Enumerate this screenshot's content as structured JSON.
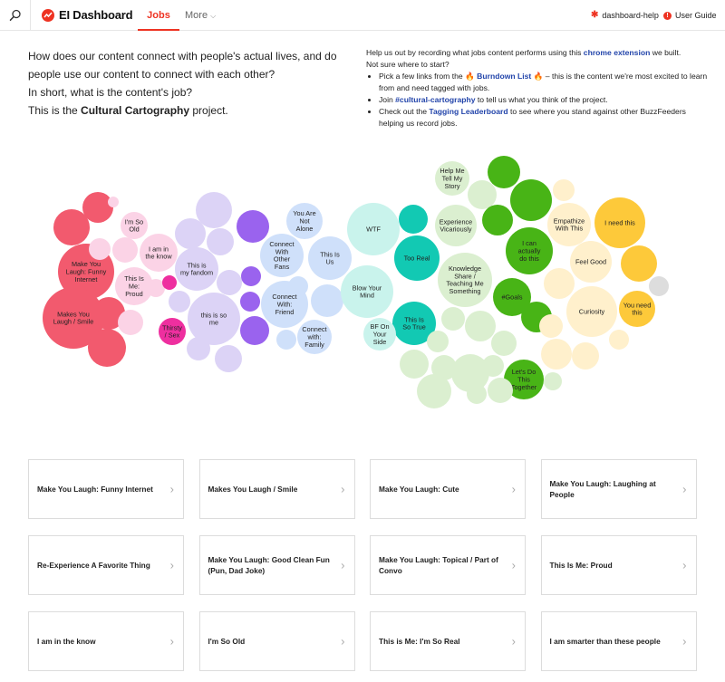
{
  "nav": {
    "brand": "EI Dashboard",
    "tabs": [
      {
        "label": "Jobs",
        "active": true
      },
      {
        "label": "More"
      }
    ],
    "help_link": "dashboard-help",
    "guide_link": "User Guide",
    "accent": "#ee3322"
  },
  "intro": {
    "line1": "How does our content connect with people's actual lives, and do people use our content to connect with each other?",
    "line2": "In short, what is the content's job?",
    "line3_pre": "This is the ",
    "line3_bold": "Cultural Cartography",
    "line3_post": " project."
  },
  "help": {
    "lead_pre": "Help us out by recording what jobs content performs using this ",
    "lead_link": "chrome extension",
    "lead_post": " we built.",
    "lead2": "Not sure where to start?",
    "b1_pre": "Pick a few links from the ",
    "b1_link": "Burndown List",
    "b1_post": " – this is the content we're most excited to learn from and need tagged with jobs.",
    "b2_pre": "Join ",
    "b2_link": "#cultural-cartography",
    "b2_post": " to tell us what you think of the project.",
    "b3_pre": "Check out the ",
    "b3_link": "Tagging Leaderboard",
    "b3_post": " to see where you stand against other BuzzFeeders helping us record jobs."
  },
  "bubbles": [
    {
      "label": "",
      "color": "#f25a6e"
    },
    {
      "label": "",
      "color": "#f25a6e"
    },
    {
      "label": "",
      "color": "#fbd3e6"
    },
    {
      "label": "I'm So Old",
      "color": "#fbd3e6"
    },
    {
      "label": "I am in the know",
      "color": "#fbd3e6"
    },
    {
      "label": "Make You Laugh: Funny Internet",
      "color": "#f25a6e"
    },
    {
      "label": "This Is Me: Proud",
      "color": "#fbd3e6"
    },
    {
      "label": "Makes You Laugh / Smile",
      "color": "#f25a6e"
    },
    {
      "label": "",
      "color": "#f25a6e"
    },
    {
      "label": "",
      "color": "#f25a6e"
    },
    {
      "label": "",
      "color": "#fbd3e6"
    },
    {
      "label": "",
      "color": "#fbd3e6"
    },
    {
      "label": "",
      "color": "#fbd3e6"
    },
    {
      "label": "",
      "color": "#fbd3e6"
    },
    {
      "label": "",
      "color": "#ee2f9f"
    },
    {
      "label": "Thirsty / Sex",
      "color": "#ee2f9f"
    },
    {
      "label": "",
      "color": "#dcd3f6"
    },
    {
      "label": "",
      "color": "#dcd3f6"
    },
    {
      "label": "",
      "color": "#9a63ee"
    },
    {
      "label": "This is my fandom",
      "color": "#dcd3f6"
    },
    {
      "label": "",
      "color": "#dcd3f6"
    },
    {
      "label": "",
      "color": "#dcd3f6"
    },
    {
      "label": "",
      "color": "#9a63ee"
    },
    {
      "label": "",
      "color": "#dcd3f6"
    },
    {
      "label": "",
      "color": "#9a63ee"
    },
    {
      "label": "this is so me",
      "color": "#dcd3f6"
    },
    {
      "label": "",
      "color": "#9a63ee"
    },
    {
      "label": "",
      "color": "#dcd3f6"
    },
    {
      "label": "",
      "color": "#dcd3f6"
    },
    {
      "label": "You Are Not Alone",
      "color": "#cfe0fa"
    },
    {
      "label": "Connect With Other Fans",
      "color": "#cfe0fa"
    },
    {
      "label": "This Is Us",
      "color": "#cfe0fa"
    },
    {
      "label": "",
      "color": "#cfe0fa"
    },
    {
      "label": "Connect With: Friend",
      "color": "#cfe0fa"
    },
    {
      "label": "",
      "color": "#cfe0fa"
    },
    {
      "label": "Connect with: Family",
      "color": "#cfe0fa"
    },
    {
      "label": "",
      "color": "#cfe0fa"
    },
    {
      "label": "WTF",
      "color": "#c9f3ec"
    },
    {
      "label": "",
      "color": "#12c9b3"
    },
    {
      "label": "Too Real",
      "color": "#12c9b3"
    },
    {
      "label": "Blow Your Mind",
      "color": "#c9f3ec"
    },
    {
      "label": "This Is So True",
      "color": "#12c9b3"
    },
    {
      "label": "BF On Your Side",
      "color": "#c9f3ec"
    },
    {
      "label": "Help Me Tell My Story",
      "color": "#dbefd0"
    },
    {
      "label": "",
      "color": "#dbefd0"
    },
    {
      "label": "",
      "color": "#48b416"
    },
    {
      "label": "Experience Vicariously",
      "color": "#dbefd0"
    },
    {
      "label": "",
      "color": "#48b416"
    },
    {
      "label": "",
      "color": "#48b416"
    },
    {
      "label": "I can actually do this",
      "color": "#48b416"
    },
    {
      "label": "Knowledge Share / Teaching Me Something",
      "color": "#dbefd0"
    },
    {
      "label": "#Goals",
      "color": "#48b416"
    },
    {
      "label": "",
      "color": "#dbefd0"
    },
    {
      "label": "",
      "color": "#dbefd0"
    },
    {
      "label": "",
      "color": "#dbefd0"
    },
    {
      "label": "",
      "color": "#dbefd0"
    },
    {
      "label": "",
      "color": "#48b416"
    },
    {
      "label": "Let's Do This Together",
      "color": "#48b416"
    },
    {
      "label": "",
      "color": "#dbefd0"
    },
    {
      "label": "",
      "color": "#dbefd0"
    },
    {
      "label": "",
      "color": "#dbefd0"
    },
    {
      "label": "",
      "color": "#dbefd0"
    },
    {
      "label": "",
      "color": "#dbefd0"
    },
    {
      "label": "",
      "color": "#dbefd0"
    },
    {
      "label": "",
      "color": "#dbefd0"
    },
    {
      "label": "",
      "color": "#dbefd0"
    },
    {
      "label": "",
      "color": "#fff0cc"
    },
    {
      "label": "Empathize With This",
      "color": "#fff0cc"
    },
    {
      "label": "I need this",
      "color": "#fdc93a"
    },
    {
      "label": "Feel Good",
      "color": "#fff0cc"
    },
    {
      "label": "",
      "color": "#fdc93a"
    },
    {
      "label": "",
      "color": "#fff0cc"
    },
    {
      "label": "Curiosity",
      "color": "#fff0cc"
    },
    {
      "label": "You need this",
      "color": "#fdc93a"
    },
    {
      "label": "",
      "color": "#fff0cc"
    },
    {
      "label": "",
      "color": "#fff0cc"
    },
    {
      "label": "",
      "color": "#fff0cc"
    },
    {
      "label": "",
      "color": "#fff0cc"
    },
    {
      "label": "",
      "color": "#dddddd"
    }
  ],
  "cards": [
    {
      "title": "Make You Laugh: Funny Internet"
    },
    {
      "title": "Makes You Laugh / Smile"
    },
    {
      "title": "Make You Laugh: Cute"
    },
    {
      "title": "Make You Laugh: Laughing at People"
    },
    {
      "title": "Re-Experience A Favorite Thing"
    },
    {
      "title": "Make You Laugh: Good Clean Fun (Pun, Dad Joke)"
    },
    {
      "title": "Make You Laugh: Topical / Part of Convo"
    },
    {
      "title": "This Is Me: Proud"
    },
    {
      "title": "I am in the know"
    },
    {
      "title": "I'm So Old"
    },
    {
      "title": "This is Me: I'm So Real"
    },
    {
      "title": "I am smarter than these people"
    }
  ]
}
